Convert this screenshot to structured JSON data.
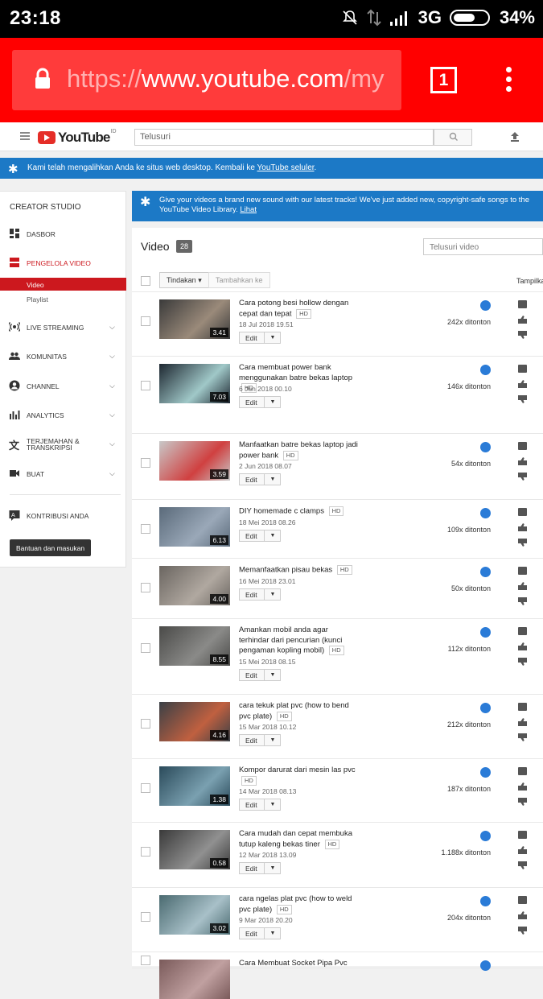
{
  "status_bar": {
    "time": "23:18",
    "network": "3G",
    "battery": "34%"
  },
  "browser": {
    "url_scheme": "https://",
    "url_host": "www.youtube.com",
    "url_path": "/my",
    "tab_count": "1"
  },
  "yt_header": {
    "logo_text": "YouTube",
    "logo_region": "ID",
    "search_placeholder": "Telusuri"
  },
  "desktop_banner": {
    "text": "Kami telah mengalihkan Anda ke situs web desktop. Kembali ke ",
    "link": "YouTube seluler",
    "suffix": "."
  },
  "sidebar": {
    "heading": "CREATOR STUDIO",
    "items": [
      {
        "label": "DASBOR",
        "icon": "dashboard-icon"
      },
      {
        "label": "PENGELOLA VIDEO",
        "icon": "video-manager-icon"
      },
      {
        "label": "LIVE STREAMING",
        "icon": "live-icon"
      },
      {
        "label": "KOMUNITAS",
        "icon": "community-icon"
      },
      {
        "label": "CHANNEL",
        "icon": "channel-icon"
      },
      {
        "label": "ANALYTICS",
        "icon": "analytics-icon"
      },
      {
        "label": "TERJEMAHAN & TRANSKRIPSI",
        "icon": "translate-icon"
      },
      {
        "label": "BUAT",
        "icon": "create-icon"
      },
      {
        "label": "KONTRIBUSI ANDA",
        "icon": "contribute-icon"
      }
    ],
    "sub_items": [
      "Video",
      "Playlist"
    ],
    "help_button": "Bantuan dan masukan"
  },
  "notice": {
    "text": "Give your videos a brand new sound with our latest tracks! We've just added new, copyright-safe songs to the YouTube Video Library. ",
    "link": "Lihat"
  },
  "main": {
    "title": "Video",
    "count": "28",
    "search_placeholder": "Telusuri video",
    "action_button": "Tindakan",
    "add_button": "Tambahkan ke",
    "view_label": "Tampilkan",
    "edit_label": "Edit",
    "hd_label": "HD"
  },
  "videos": [
    {
      "title": "Cara potong besi hollow dengan cepat dan tepat",
      "date": "18 Jul 2018 19.51",
      "duration": "3.41",
      "views": "242x ditonton"
    },
    {
      "title": "Cara membuat power bank menggunakan batre bekas laptop",
      "date": "6 Jun 2018 00.10",
      "duration": "7.03",
      "views": "146x ditonton"
    },
    {
      "title": "Manfaatkan batre bekas laptop jadi power bank",
      "date": "2 Jun 2018 08.07",
      "duration": "3.59",
      "views": "54x ditonton"
    },
    {
      "title": "DIY homemade c clamps",
      "date": "18 Mei 2018 08.26",
      "duration": "6.13",
      "views": "109x ditonton"
    },
    {
      "title": "Memanfaatkan pisau bekas",
      "date": "16 Mei 2018 23.01",
      "duration": "4.00",
      "views": "50x ditonton"
    },
    {
      "title": "Amankan mobil anda agar terhindar dari pencurian (kunci pengaman kopling mobil)",
      "date": "15 Mei 2018 08.15",
      "duration": "8.55",
      "views": "112x ditonton"
    },
    {
      "title": "cara tekuk plat pvc (how to bend pvc plate)",
      "date": "15 Mar 2018 10.12",
      "duration": "4.16",
      "views": "212x ditonton"
    },
    {
      "title": "Kompor darurat dari mesin las pvc",
      "date": "14 Mar 2018 08.13",
      "duration": "1.38",
      "views": "187x ditonton"
    },
    {
      "title": "Cara mudah dan cepat membuka tutup kaleng bekas tiner",
      "date": "12 Mar 2018 13.09",
      "duration": "0.58",
      "views": "1.188x ditonton"
    },
    {
      "title": "cara ngelas plat pvc (how to weld pvc plate)",
      "date": "9 Mar 2018 20.20",
      "duration": "3.02",
      "views": "204x ditonton"
    },
    {
      "title": "Cara Membuat Socket Pipa Pvc",
      "date": "",
      "duration": "",
      "views": ""
    }
  ],
  "colors": {
    "accent": "#cc181e",
    "chrome_red": "#ff0000",
    "banner_blue": "#1c79c6"
  }
}
